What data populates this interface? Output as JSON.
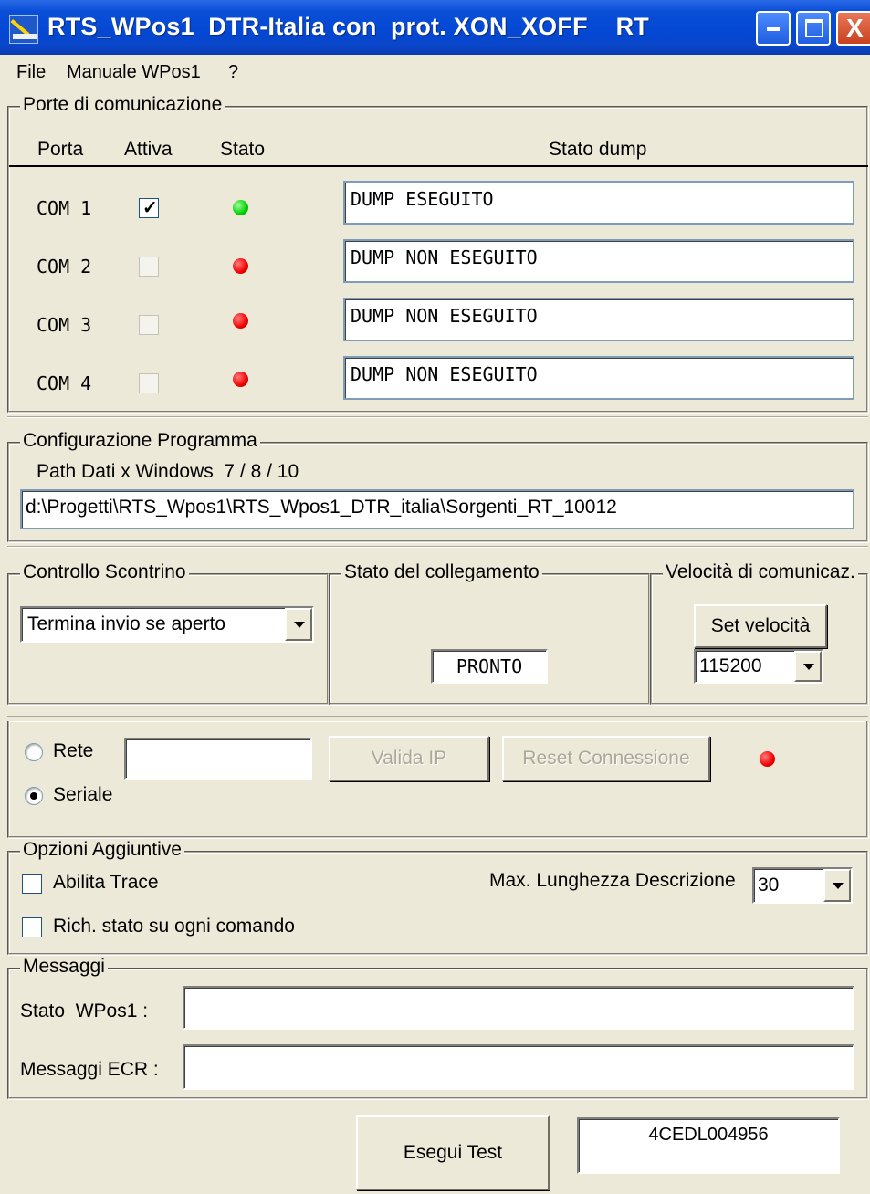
{
  "window": {
    "title": "RTS_WPos1  DTR-Italia con  prot. XON_XOFF    RT",
    "minimize_label": "_",
    "maximize_label": "□",
    "close_label": "X"
  },
  "menu": [
    "File",
    "Manuale WPos1",
    "?"
  ],
  "ports": {
    "group_label": "Porte di comunicazione",
    "headers": {
      "porta": "Porta",
      "attiva": "Attiva",
      "stato": "Stato",
      "dump": "Stato dump"
    },
    "rows": [
      {
        "name": "COM 1",
        "active": true,
        "status": "green",
        "dump": "DUMP ESEGUITO"
      },
      {
        "name": "COM 2",
        "active": false,
        "status": "red",
        "dump": "DUMP NON ESEGUITO"
      },
      {
        "name": "COM 3",
        "active": false,
        "status": "red",
        "dump": "DUMP NON ESEGUITO"
      },
      {
        "name": "COM 4",
        "active": false,
        "status": "red",
        "dump": "DUMP NON ESEGUITO"
      }
    ]
  },
  "config": {
    "group_label": "Configurazione Programma",
    "path_label": "Path Dati x Windows  7 / 8 / 10",
    "path_value": "d:\\Progetti\\RTS_Wpos1\\RTS_Wpos1_DTR_italia\\Sorgenti_RT_10012"
  },
  "controllo": {
    "group_label": "Controllo Scontrino",
    "selected": "Termina invio se aperto"
  },
  "collegamento": {
    "group_label": "Stato del collegamento",
    "status": "PRONTO"
  },
  "velocita": {
    "group_label": "Velocità di comunicaz.",
    "button": "Set velocità",
    "selected": "115200"
  },
  "connection": {
    "rete_label": "Rete",
    "seriale_label": "Seriale",
    "selected": "Seriale",
    "ip_value": "",
    "valida_button": "Valida IP",
    "reset_button": "Reset Connessione",
    "status_color": "#f00000"
  },
  "options": {
    "group_label": "Opzioni Aggiuntive",
    "trace_label": "Abilita Trace",
    "trace_checked": false,
    "stato_label": "Rich. stato su ogni comando",
    "stato_checked": false,
    "maxlen_label": "Max. Lunghezza Descrizione",
    "maxlen_value": "30"
  },
  "messages": {
    "group_label": "Messaggi",
    "stato_label": "Stato  WPos1 :",
    "stato_value": "",
    "ecr_label": "Messaggi ECR :",
    "ecr_value": ""
  },
  "footer": {
    "test_button": "Esegui Test",
    "serial": "4CEDL004956"
  }
}
